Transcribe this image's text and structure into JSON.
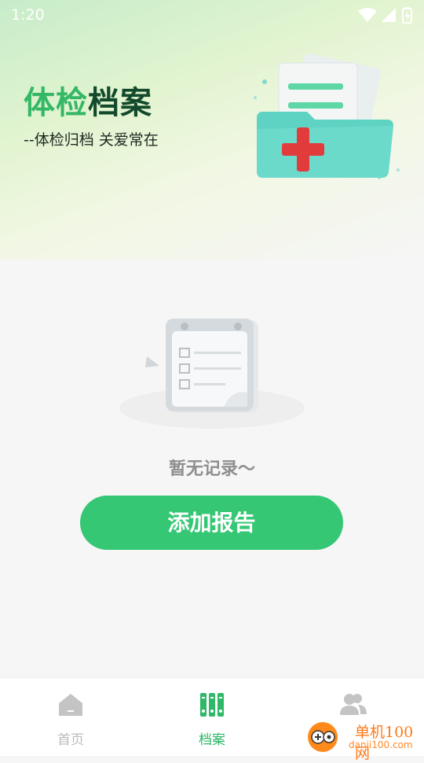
{
  "status_bar": {
    "time": "1:20"
  },
  "header": {
    "title_part1": "体检",
    "title_part2": "档案",
    "subtitle": "--体检归档 关爱常在"
  },
  "empty_state": {
    "message": "暂无记录～"
  },
  "actions": {
    "add_report_label": "添加报告"
  },
  "bottom_nav": {
    "items": [
      {
        "label": "首页",
        "icon": "home-icon",
        "active": false
      },
      {
        "label": "档案",
        "icon": "archive-icon",
        "active": true
      },
      {
        "label": "",
        "icon": "users-icon",
        "active": false
      }
    ]
  },
  "watermark": {
    "name": "单机100网",
    "url": "danji100.com"
  },
  "colors": {
    "accent": "#35c774",
    "title_light": "#35b866",
    "title_dark": "#134a2c",
    "inactive_nav": "#bbbbbb"
  }
}
